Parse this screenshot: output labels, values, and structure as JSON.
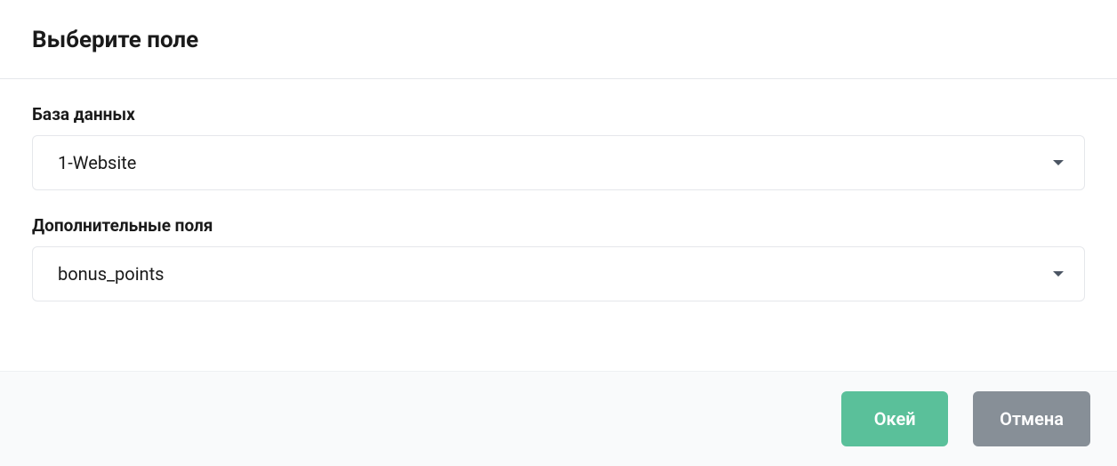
{
  "header": {
    "title": "Выберите поле"
  },
  "form": {
    "database": {
      "label": "База данных",
      "value": "1-Website"
    },
    "additionalFields": {
      "label": "Дополнительные поля",
      "value": "bonus_points"
    }
  },
  "footer": {
    "ok_label": "Окей",
    "cancel_label": "Отмена"
  }
}
